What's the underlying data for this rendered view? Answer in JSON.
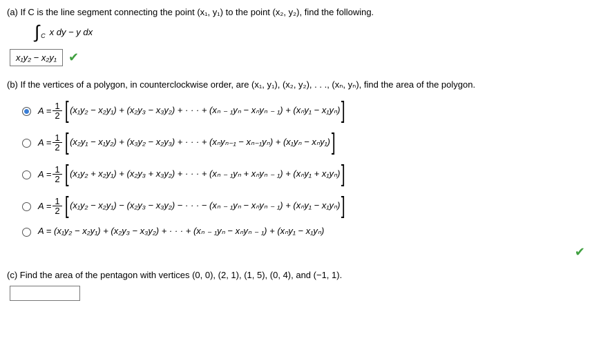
{
  "part_a": {
    "label": "(a) If C is the line segment connecting the point  (x₁, y₁)  to the point  (x₂, y₂),  find the following.",
    "integral": "x dy − y dx",
    "int_sub": "C",
    "answer": "x₁y₂ − x₂y₁"
  },
  "part_b": {
    "label": "(b) If the vertices of a polygon, in counterclockwise order, are  (x₁, y₁), (x₂, y₂), . . ., (xₙ, yₙ),  find the area of the polygon.",
    "options": {
      "o1": "(x₁y₂ − x₂y₁) + (x₂y₃ − x₃y₂) + · · · + (xₙ ₋ ₁yₙ − xₙyₙ ₋ ₁) + (xₙy₁ − x₁yₙ)",
      "o2": "(x₂y₁ − x₁y₂) + (x₃y₂ − x₂y₃) + · · · + (xₙyₙ₋₁ − xₙ₋₁yₙ) + (x₁yₙ − xₙy₁)",
      "o3": "(x₁y₂ + x₂y₁) + (x₂y₃ + x₃y₂) + · · · + (xₙ ₋ ₁yₙ + xₙyₙ ₋ ₁) + (xₙy₁ + x₁yₙ)",
      "o4": "(x₁y₂ − x₂y₁) − (x₂y₃ − x₃y₂) − · · · − (xₙ ₋ ₁yₙ − xₙyₙ ₋ ₁) + (xₙy₁ − x₁yₙ)",
      "o5": "A = (x₁y₂ − x₂y₁) + (x₂y₃ − x₃y₂) + · · · + (xₙ ₋ ₁yₙ − xₙyₙ ₋ ₁) + (xₙy₁ − x₁yₙ)"
    },
    "A_prefix": "A = ",
    "half_num": "1",
    "half_den": "2"
  },
  "part_c": {
    "label": "(c) Find the area of the pentagon with vertices (0, 0), (2, 1), (1, 5), (0, 4), and (−1, 1)."
  },
  "check_glyph": "✔"
}
